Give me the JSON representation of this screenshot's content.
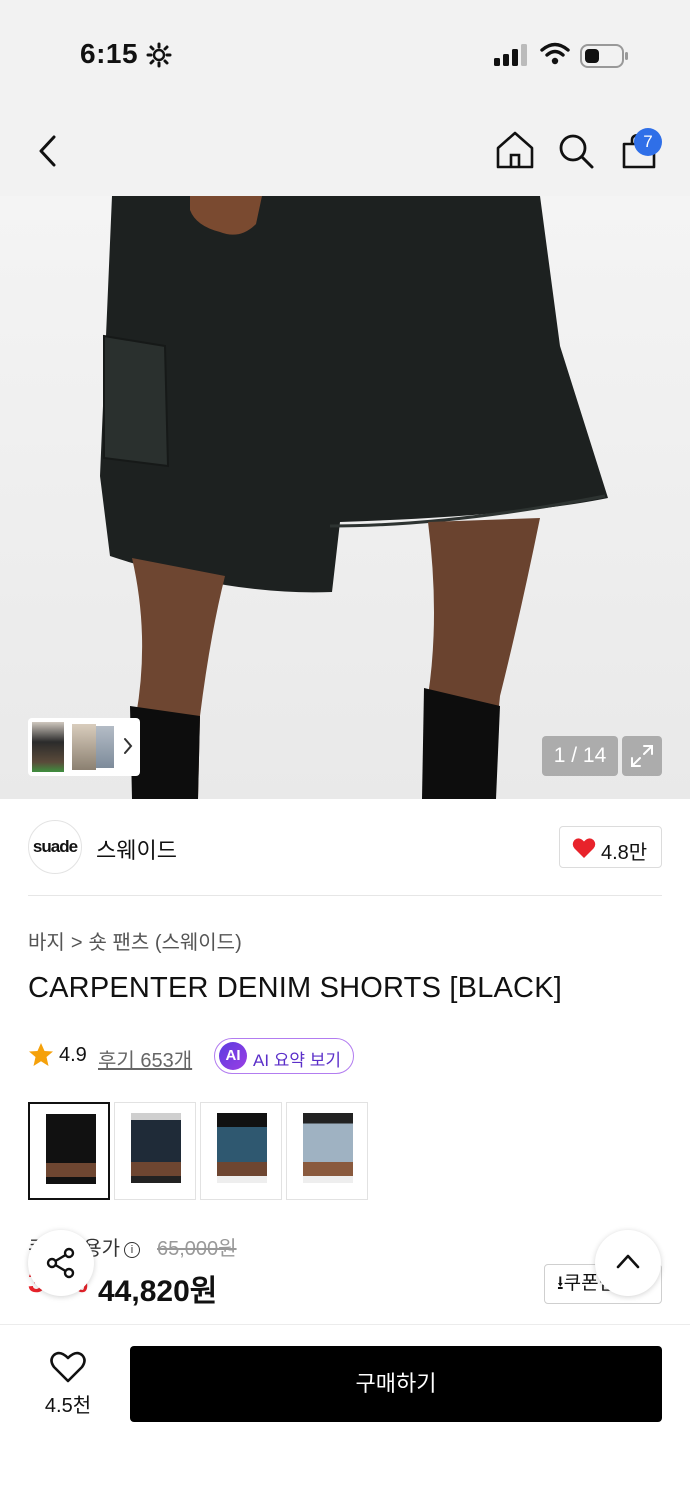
{
  "status_bar": {
    "time": "6:15"
  },
  "nav": {
    "cart_count": "7"
  },
  "gallery": {
    "pager": "1 / 14"
  },
  "brand": {
    "logo_text": "suade",
    "name": "스웨이드",
    "likes": "4.8만"
  },
  "breadcrumb": {
    "category": "바지",
    "separator": ">",
    "subcategory": "숏 팬츠 (스웨이드)"
  },
  "product": {
    "title": "CARPENTER DENIM SHORTS [BLACK]",
    "rating": "4.9",
    "reviews_label": "후기 653개",
    "ai_badge": "AI",
    "ai_summary_label": "AI 요약 보기",
    "price_label": "쿠폰적용가",
    "original_price": "65,000원",
    "discount_rate": "31%",
    "final_price": "44,820원",
    "coupon_label": "쿠폰받기"
  },
  "swatches": [
    {
      "name": "BLACK"
    },
    {
      "name": "NAVY"
    },
    {
      "name": "BLUE"
    },
    {
      "name": "LIGHT BLUE"
    }
  ],
  "bottom_bar": {
    "wish_count": "4.5천",
    "buy_label": "구매하기"
  },
  "colors": {
    "accent_blue": "#2f6fe8",
    "heart_red": "#e8232b",
    "ai_purple": "#5b2fc9",
    "primary_black": "#000000"
  }
}
